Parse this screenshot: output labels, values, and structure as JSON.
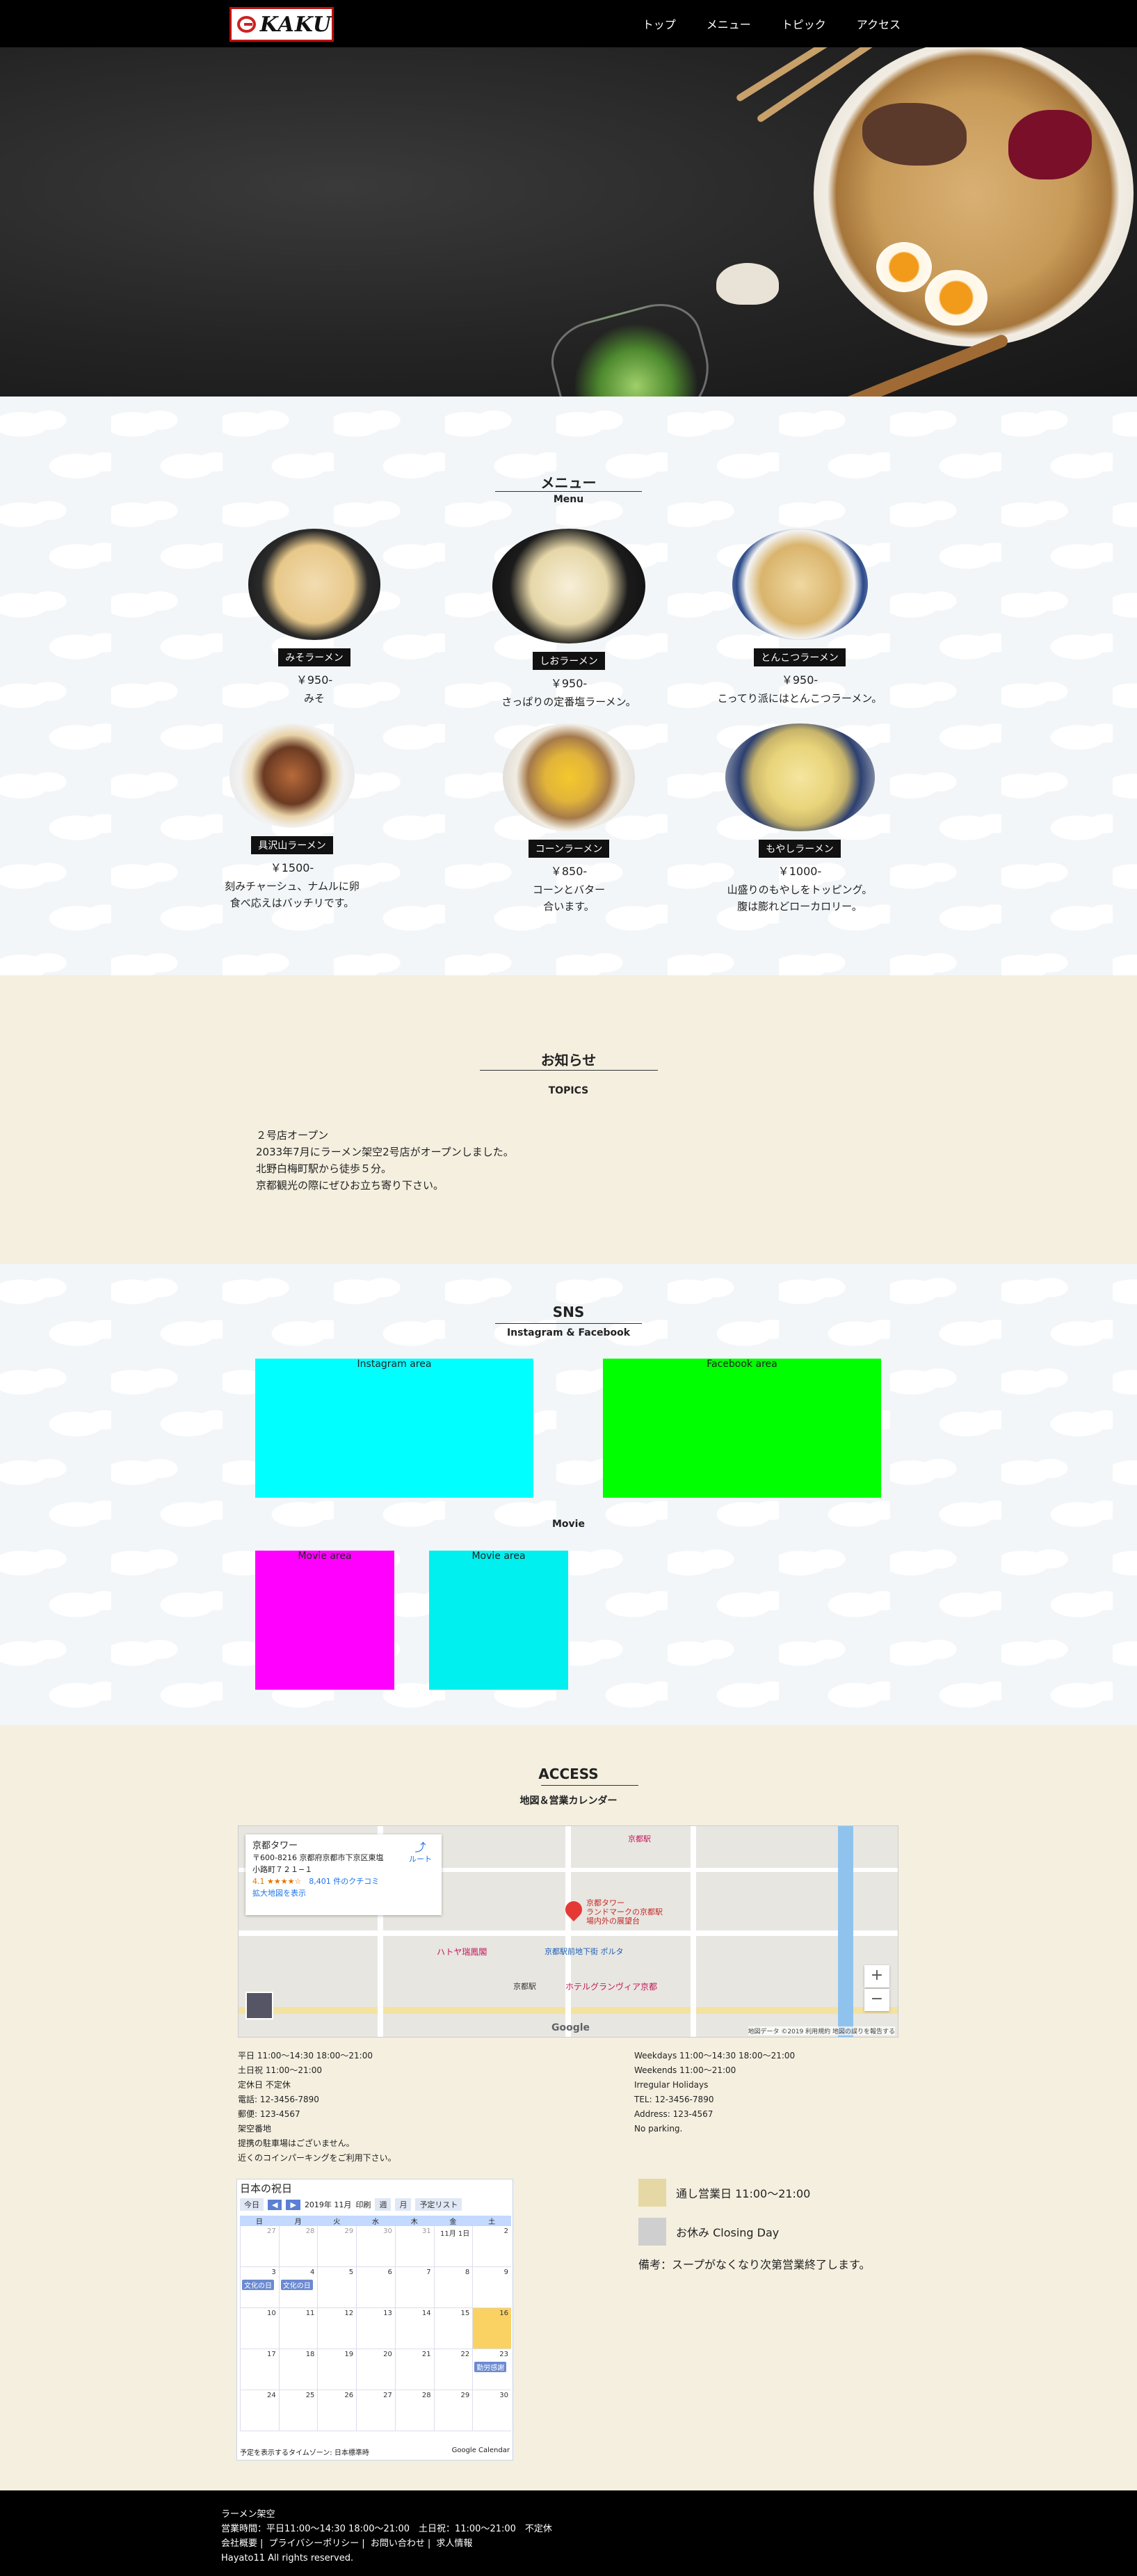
{
  "header": {
    "logo_text": "KAKU",
    "nav": [
      "トップ",
      "メニュー",
      "トピック",
      "アクセス"
    ]
  },
  "menu": {
    "title": "メニュー",
    "subtitle": "Menu",
    "items": [
      {
        "name": "みそラーメン",
        "price": "￥950-",
        "desc1": "みそ",
        "desc2": ""
      },
      {
        "name": "しおラーメン",
        "price": "￥950-",
        "desc1": "さっぱりの定番塩ラーメン。",
        "desc2": ""
      },
      {
        "name": "とんこつラーメン",
        "price": "￥950-",
        "desc1": "こってり派にはとんこつラーメン。",
        "desc2": ""
      },
      {
        "name": "具沢山ラーメン",
        "price": "￥1500-",
        "desc1": "刻みチャーシュ、ナムルに卵",
        "desc2": "食べ応えはバッチリです。"
      },
      {
        "name": "コーンラーメン",
        "price": "￥850-",
        "desc1": "コーンとバター",
        "desc2": "合います。"
      },
      {
        "name": "もやしラーメン",
        "price": "￥1000-",
        "desc1": "山盛りのもやしをトッピング。",
        "desc2": "腹は膨れどローカロリー。"
      }
    ]
  },
  "topics": {
    "title": "お知らせ",
    "subtitle": "TOPICS",
    "lines": [
      "２号店オープン",
      "2033年7月にラーメン架空2号店がオープンしました。",
      "北野白梅町駅から徒歩５分。",
      "京都観光の際にぜひお立ち寄り下さい。"
    ]
  },
  "sns": {
    "title": "SNS",
    "subtitle": "Instagram & Facebook",
    "instagram_label": "Instagram area",
    "facebook_label": "Facebook area",
    "movie_title": "Movie",
    "movie_label_1": "Movie area",
    "movie_label_2": "Movie area",
    "colors": {
      "instagram": "#00ffff",
      "facebook": "#00ff00",
      "movie1": "#ff00ff",
      "movie2": "#00f0f0"
    }
  },
  "access": {
    "title": "ACCESS",
    "subtitle": "地図＆営業カレンダー",
    "map": {
      "place_name": "京都タワー",
      "address_1": "〒600-8216 京都府京都市下京区東塩",
      "address_2": "小路町７２１−１",
      "rating": "4.1 ★★★★☆",
      "reviews": "8,401 件のクチコミ",
      "route": "ルート",
      "larger_map": "拡大地図を表示",
      "pin_label_1": "京都タワー",
      "pin_label_2": "ランドマークの京都駅",
      "pin_label_3": "場内外の展望台",
      "poi_1": "京都駅",
      "poi_2": "京都駅前地下街 ポルタ",
      "poi_3": "ハトヤ瑞鳳閣",
      "poi_4": "ホテルグランヴィア京都",
      "poi_5": "京都駅",
      "google": "Google",
      "attribution": "地図データ ©2019 利用規約 地図の誤りを報告する"
    },
    "info_jp": [
      "平日 11:00〜14:30 18:00〜21:00",
      "土日祝 11:00〜21:00",
      "定休日 不定休",
      "電話: 12-3456-7890",
      "郵便: 123-4567",
      "架空番地",
      "提携の駐車場はございません。",
      "近くのコインパーキングをご利用下さい。"
    ],
    "info_en": [
      "Weekdays 11:00〜14:30 18:00〜21:00",
      "Weekends 11:00〜21:00",
      "Irregular Holidays",
      "TEL: 12-3456-7890",
      "Address: 123-4567",
      "No parking."
    ],
    "calendar": {
      "title": "日本の祝日",
      "today_btn": "今日",
      "month": "2019年 11月",
      "print": "印刷",
      "week": "週",
      "month_view": "月",
      "schedule": "予定リスト",
      "weekdays": [
        "日",
        "月",
        "火",
        "水",
        "木",
        "金",
        "土"
      ],
      "weeks": [
        [
          "27",
          "28",
          "29",
          "30",
          "31",
          "11月 1日",
          "2"
        ],
        [
          "3",
          "4",
          "5",
          "6",
          "7",
          "8",
          "9"
        ],
        [
          "10",
          "11",
          "12",
          "13",
          "14",
          "15",
          "16"
        ],
        [
          "17",
          "18",
          "19",
          "20",
          "21",
          "22",
          "23"
        ],
        [
          "24",
          "25",
          "26",
          "27",
          "28",
          "29",
          "30"
        ]
      ],
      "events": {
        "e1": "文化の日",
        "e2": "文化の日",
        "e3": "勤労感謝"
      },
      "timezone": "予定を表示するタイムゾーン: 日本標準時",
      "brand": "Google Calendar"
    },
    "legend": {
      "open": "通し営業日 11:00〜21:00",
      "closed": "お休み Closing Day",
      "note": "備考：スープがなくなり次第営業終了します。",
      "open_color": "#e6d8a4",
      "closed_color": "#cfcfcf"
    }
  },
  "footer": {
    "shop_name": "ラーメン架空",
    "hours": "営業時間：平日11:00〜14:30 18:00〜21:00　土日祝：11:00〜21:00　不定休",
    "links": [
      "会社概要",
      "プライバシーポリシー",
      "お問い合わせ",
      "求人情報"
    ],
    "copyright": "Hayato11 All rights reserved."
  }
}
